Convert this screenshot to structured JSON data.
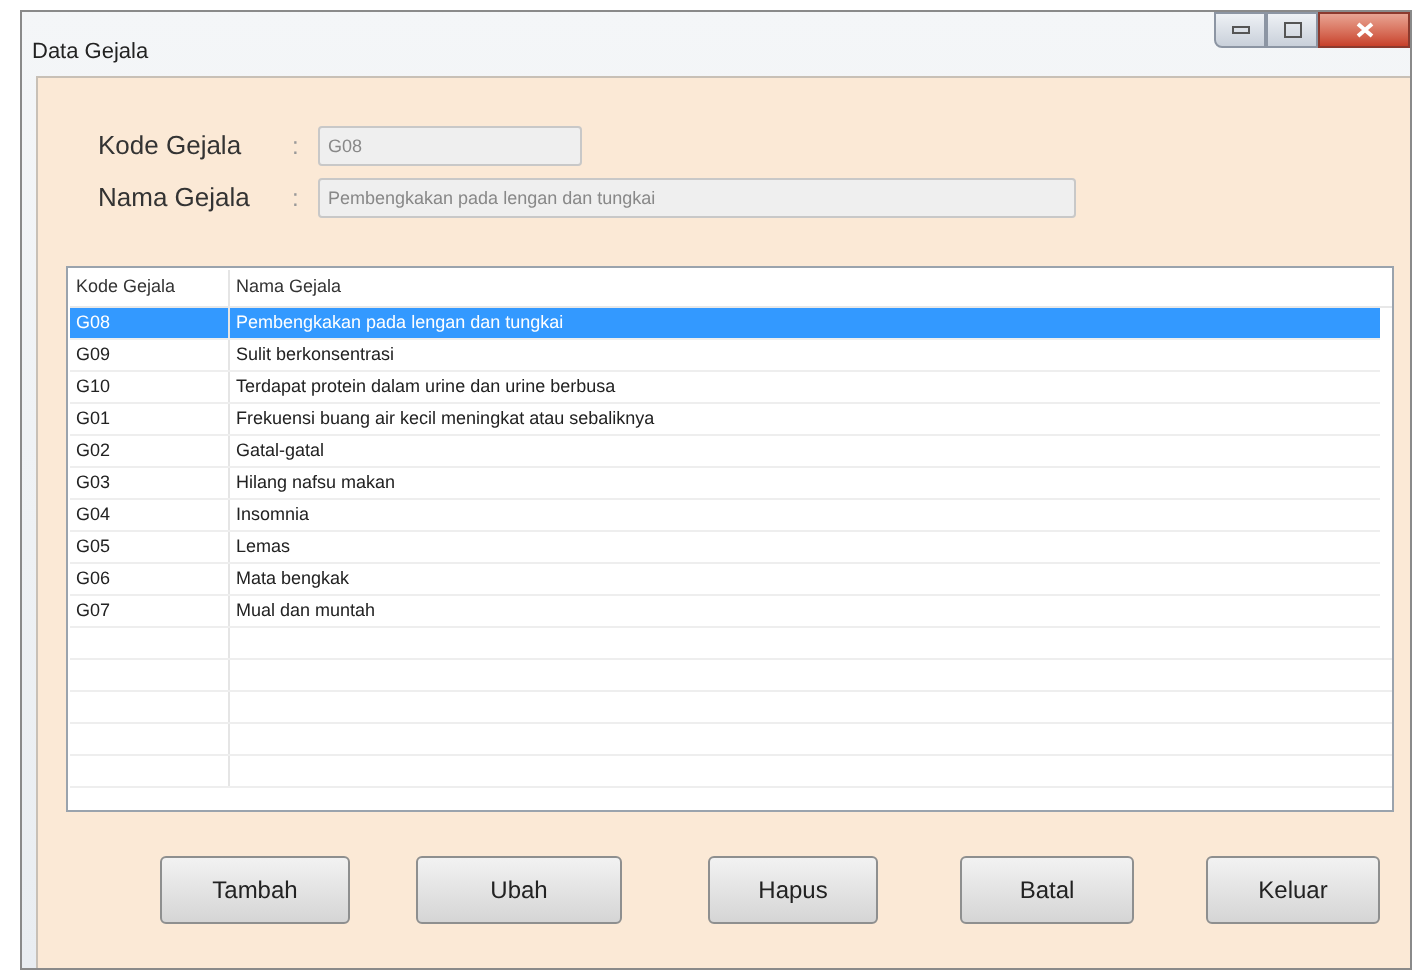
{
  "window": {
    "title": "Data Gejala"
  },
  "form": [
    {
      "label": "Kode Gejala",
      "separator": ":",
      "value": "G08",
      "kind": "short"
    },
    {
      "label": "Nama Gejala",
      "separator": ":",
      "value": "Pembengkakan pada lengan dan tungkai",
      "kind": "long"
    }
  ],
  "table": {
    "columns": [
      "Kode Gejala",
      "Nama Gejala"
    ],
    "rows": [
      {
        "cells": [
          "G08",
          "Pembengkakan pada lengan dan tungkai"
        ],
        "selected": true
      },
      {
        "cells": [
          "G09",
          "Sulit berkonsentrasi"
        ],
        "selected": false
      },
      {
        "cells": [
          "G10",
          "Terdapat protein dalam urine dan urine berbusa"
        ],
        "selected": false
      },
      {
        "cells": [
          "G01",
          "Frekuensi buang air kecil meningkat atau sebaliknya"
        ],
        "selected": false
      },
      {
        "cells": [
          "G02",
          "Gatal-gatal"
        ],
        "selected": false
      },
      {
        "cells": [
          "G03",
          "Hilang nafsu makan"
        ],
        "selected": false
      },
      {
        "cells": [
          "G04",
          "Insomnia"
        ],
        "selected": false
      },
      {
        "cells": [
          "G05",
          "Lemas"
        ],
        "selected": false
      },
      {
        "cells": [
          "G06",
          "Mata bengkak"
        ],
        "selected": false
      },
      {
        "cells": [
          "G07",
          "Mual dan muntah"
        ],
        "selected": false
      }
    ]
  },
  "buttons": [
    "Tambah",
    "Ubah",
    "Hapus",
    "Batal",
    "Keluar"
  ]
}
